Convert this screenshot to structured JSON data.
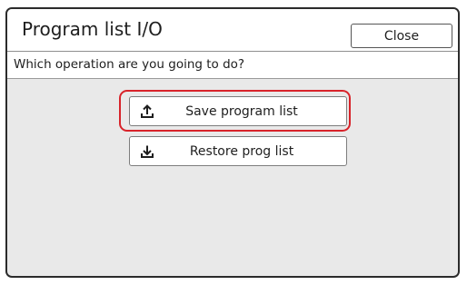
{
  "dialog": {
    "title": "Program list I/O",
    "close_label": "Close",
    "prompt": "Which operation are you going to do?"
  },
  "operations": [
    {
      "label": "Save program list",
      "icon": "upload-icon",
      "highlighted": true
    },
    {
      "label": "Restore prog list",
      "icon": "download-icon",
      "highlighted": false
    }
  ],
  "colors": {
    "highlight": "#d8232a",
    "panel_background": "#e9e9e9",
    "frame_border": "#2b2b2b"
  }
}
